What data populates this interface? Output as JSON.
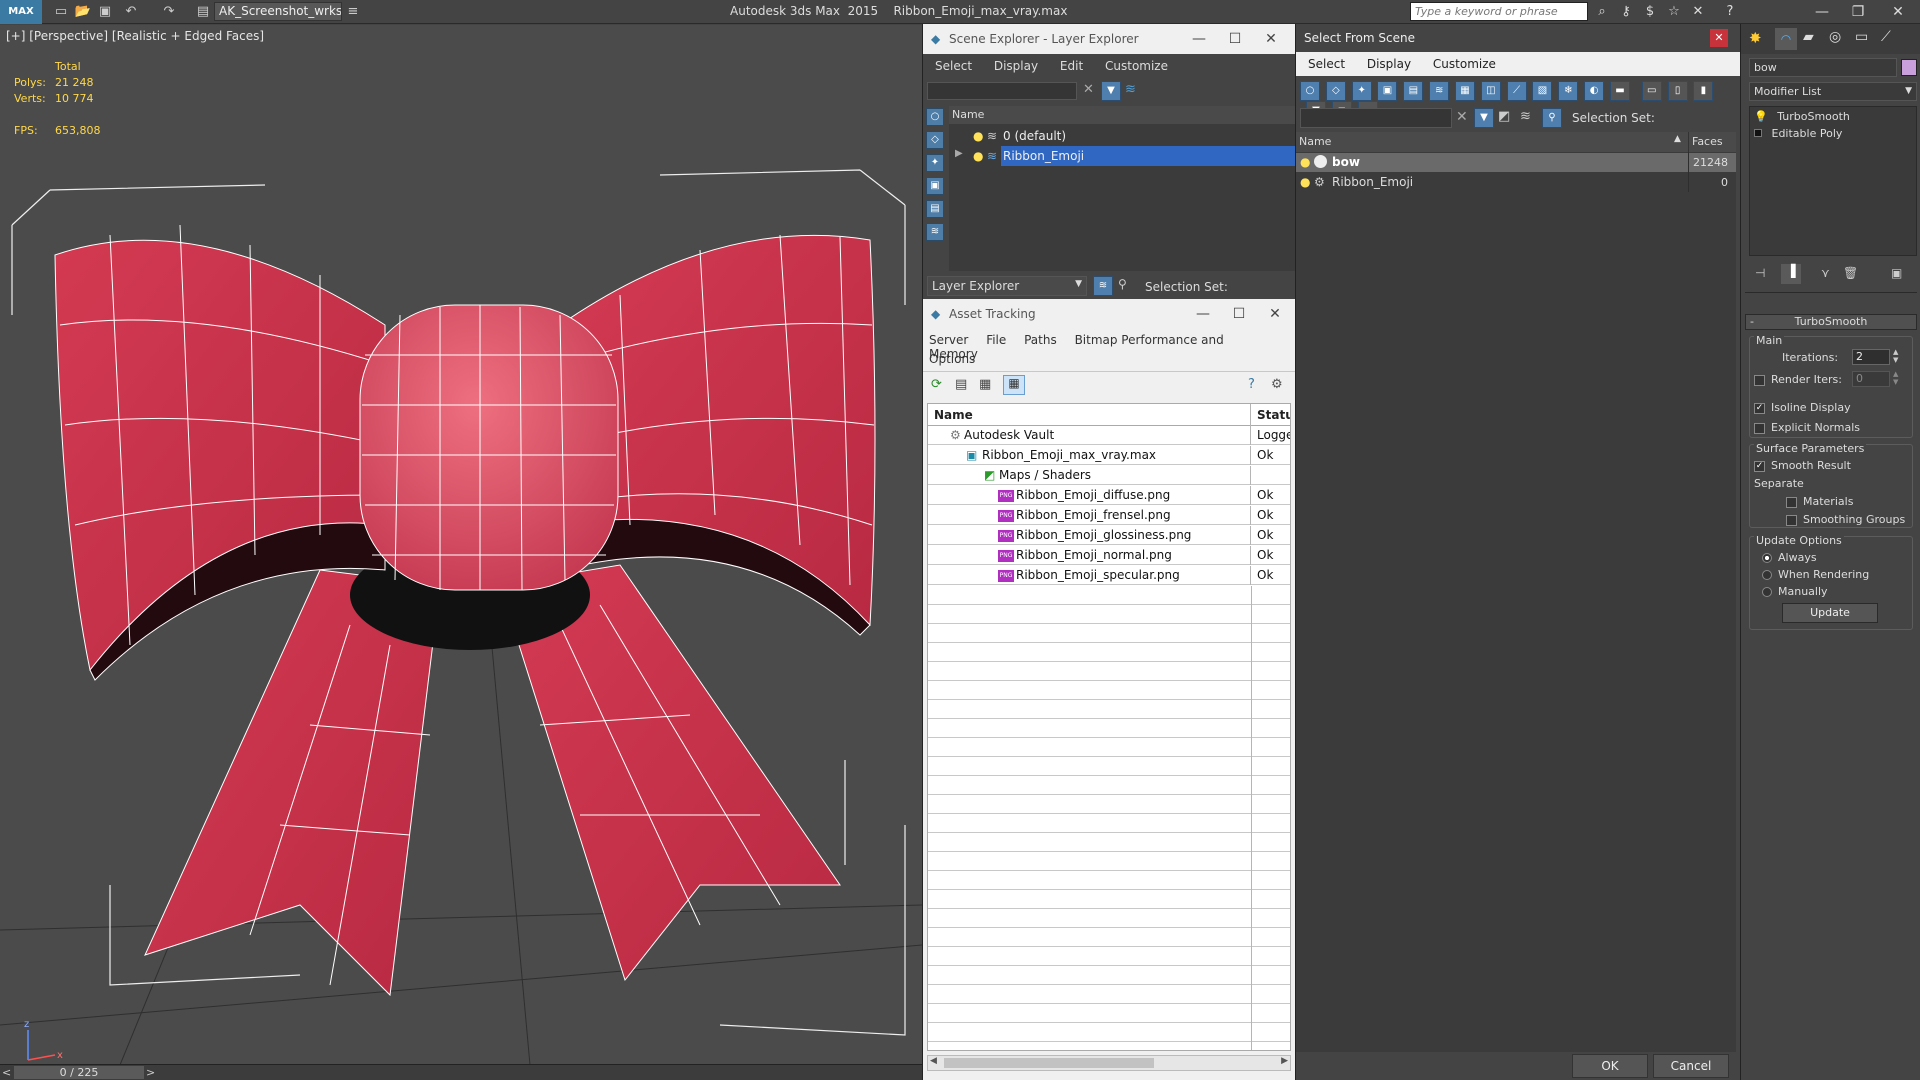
{
  "app": {
    "title": "Autodesk 3ds Max  2015",
    "filename": "Ribbon_Emoji_max_vray.max",
    "logo": "MAX",
    "workspace": "AK_Screenshot_wrksp",
    "search_placeholder": "Type a keyword or phrase"
  },
  "viewport": {
    "label": "[+] [Perspective] [Realistic + Edged Faces]",
    "stats": {
      "total_label": "Total",
      "polys_label": "Polys:",
      "polys_value": "21 248",
      "verts_label": "Verts:",
      "verts_value": "10 774",
      "fps_label": "FPS:",
      "fps_value": "653,808"
    },
    "axis": {
      "z": "z",
      "x": "x"
    },
    "colors": {
      "ribbon": "#c4324a",
      "ribbon_light": "#e65b6e",
      "wire": "#ffffff",
      "bg": "#4b4b4b"
    }
  },
  "timeline": {
    "frame": "0 / 225",
    "prev": "<",
    "next": ">"
  },
  "scene_explorer": {
    "title": "Scene Explorer - Layer Explorer",
    "menu": [
      "Select",
      "Display",
      "Edit",
      "Customize"
    ],
    "column_name": "Name",
    "rows": [
      "0 (default)",
      "Ribbon_Emoji"
    ],
    "footer_combo": "Layer Explorer",
    "selection_set_label": "Selection Set:"
  },
  "asset_tracking": {
    "title": "Asset Tracking",
    "menu": [
      "Server",
      "File",
      "Paths",
      "Bitmap Performance and Memory",
      "Options"
    ],
    "columns": {
      "name": "Name",
      "status": "Status"
    },
    "rows": [
      {
        "name": "Autodesk Vault",
        "status": "Logged"
      },
      {
        "name": "Ribbon_Emoji_max_vray.max",
        "status": "Ok"
      },
      {
        "name": "Maps / Shaders",
        "status": ""
      },
      {
        "name": "Ribbon_Emoji_diffuse.png",
        "status": "Ok"
      },
      {
        "name": "Ribbon_Emoji_frensel.png",
        "status": "Ok"
      },
      {
        "name": "Ribbon_Emoji_glossiness.png",
        "status": "Ok"
      },
      {
        "name": "Ribbon_Emoji_normal.png",
        "status": "Ok"
      },
      {
        "name": "Ribbon_Emoji_specular.png",
        "status": "Ok"
      }
    ],
    "png_badge": "PNG"
  },
  "select_from_scene": {
    "title": "Select From Scene",
    "menu": [
      "Select",
      "Display",
      "Customize"
    ],
    "selection_set_label": "Selection Set:",
    "columns": {
      "name": "Name",
      "faces": "Faces"
    },
    "rows": [
      {
        "name": "bow",
        "faces": "21248"
      },
      {
        "name": "Ribbon_Emoji",
        "faces": "0"
      }
    ],
    "ok": "OK",
    "cancel": "Cancel"
  },
  "command_panel": {
    "object_name": "bow",
    "modifier_list": "Modifier List",
    "stack": [
      "TurboSmooth",
      "Editable Poly"
    ],
    "rollout_title": "TurboSmooth",
    "main_label": "Main",
    "iterations_label": "Iterations:",
    "iterations_value": "2",
    "render_iters_label": "Render Iters:",
    "render_iters_value": "0",
    "isoline_display": "Isoline Display",
    "explicit_normals": "Explicit Normals",
    "surface_parameters": "Surface Parameters",
    "smooth_result": "Smooth Result",
    "separate": "Separate",
    "materials": "Materials",
    "smoothing_groups": "Smoothing Groups",
    "update_options": "Update Options",
    "always": "Always",
    "when_rendering": "When Rendering",
    "manually": "Manually",
    "update_button": "Update",
    "object_color": "#c9a0dc"
  }
}
